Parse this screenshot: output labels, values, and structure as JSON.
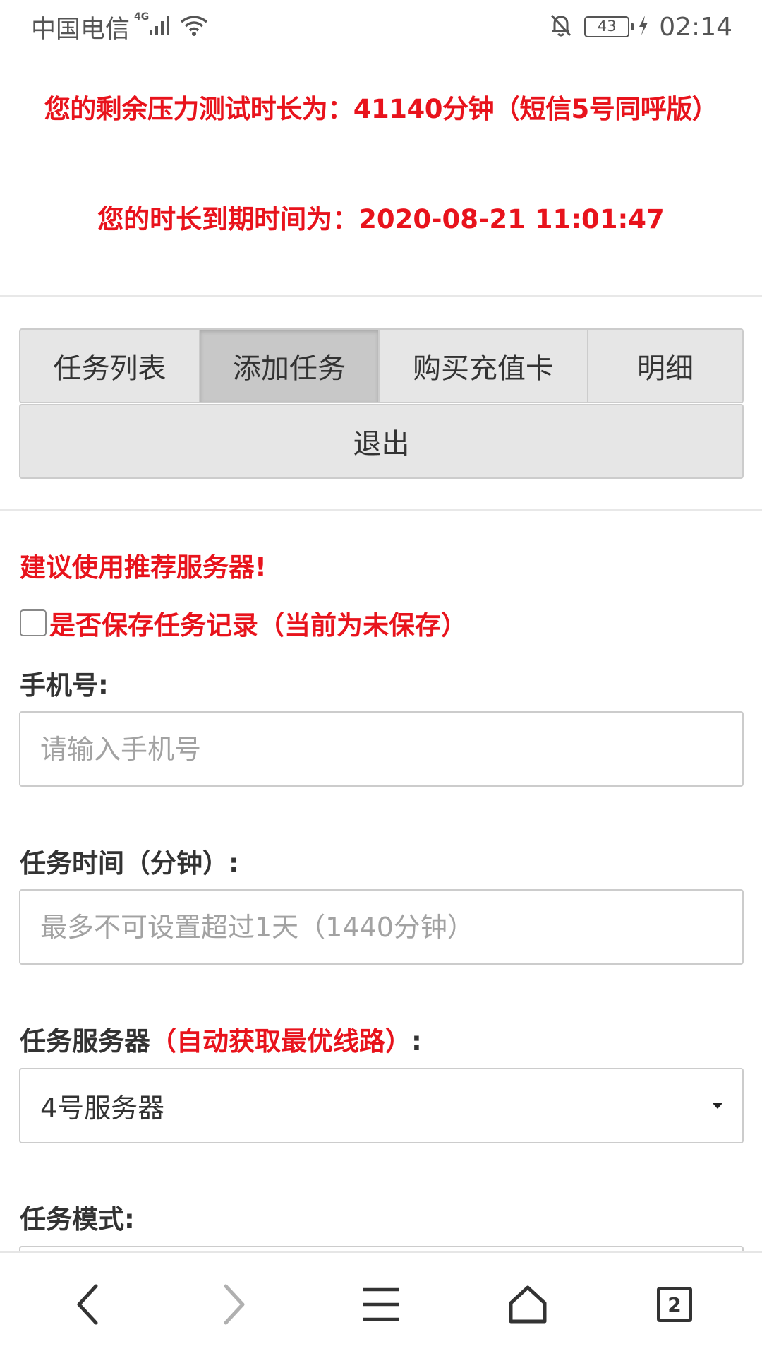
{
  "status_bar": {
    "carrier": "中国电信",
    "network_type": "4G",
    "battery": "43",
    "time": "02:14",
    "icons": [
      "signal-icon",
      "wifi-icon",
      "mute-notification-icon",
      "battery-icon",
      "charging-icon"
    ]
  },
  "banner": {
    "remaining_time": "您的剩余压力测试时长为：41140分钟（短信5号同呼版）",
    "expire_time": "您的时长到期时间为：2020-08-21 11:01:47"
  },
  "nav": {
    "tabs": [
      {
        "label": "任务列表",
        "active": false
      },
      {
        "label": "添加任务",
        "active": true
      },
      {
        "label": "购买充值卡",
        "active": false
      },
      {
        "label": "明细",
        "active": false
      }
    ],
    "logout_label": "退出"
  },
  "form": {
    "recommend_tip": "建议使用推荐服务器!",
    "save_record_label": "是否保存任务记录（当前为未保存）",
    "save_record_checked": false,
    "phone_label": "手机号:",
    "phone_placeholder": "请输入手机号",
    "phone_value": "",
    "duration_label": "任务时间（分钟）:",
    "duration_placeholder": "最多不可设置超过1天（1440分钟）",
    "duration_value": "",
    "server_label": "任务服务器",
    "server_hint": "（自动获取最优线路）",
    "server_label_suffix": ":",
    "server_selected": "4号服务器",
    "mode_label": "任务模式:"
  },
  "browser_bar": {
    "icons": [
      "back-icon",
      "forward-icon",
      "menu-icon",
      "home-icon",
      "tabs-icon"
    ],
    "tab_count": "2"
  },
  "colors": {
    "accent_red": "#e8131c",
    "button_gray": "#e6e6e6",
    "button_active_gray": "#c8c8c8",
    "border_gray": "#cccccc"
  }
}
